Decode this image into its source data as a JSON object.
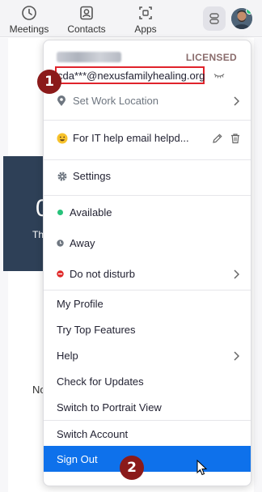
{
  "nav": {
    "meetings": "Meetings",
    "contacts": "Contacts",
    "apps": "Apps"
  },
  "background": {
    "card_big": "0",
    "card_small": "Th",
    "text": "No"
  },
  "menu": {
    "license": "LICENSED",
    "email": "cda***@nexusfamilyhealing.org",
    "work_location": "Set Work Location",
    "status_message": "For IT help email helpd...",
    "settings": "Settings",
    "available": "Available",
    "away": "Away",
    "do_not_disturb": "Do not disturb",
    "my_profile": "My Profile",
    "try_top_features": "Try Top Features",
    "help": "Help",
    "check_for_updates": "Check for Updates",
    "switch_portrait": "Switch to Portrait View",
    "switch_account": "Switch Account",
    "sign_out": "Sign Out"
  },
  "callouts": {
    "one": "1",
    "two": "2"
  },
  "colors": {
    "accent": "#0e71eb",
    "available": "#27c27a",
    "away": "#6e7680",
    "dnd": "#e02828",
    "callout": "#8b1a1a",
    "highlight_box": "#e0232b"
  }
}
